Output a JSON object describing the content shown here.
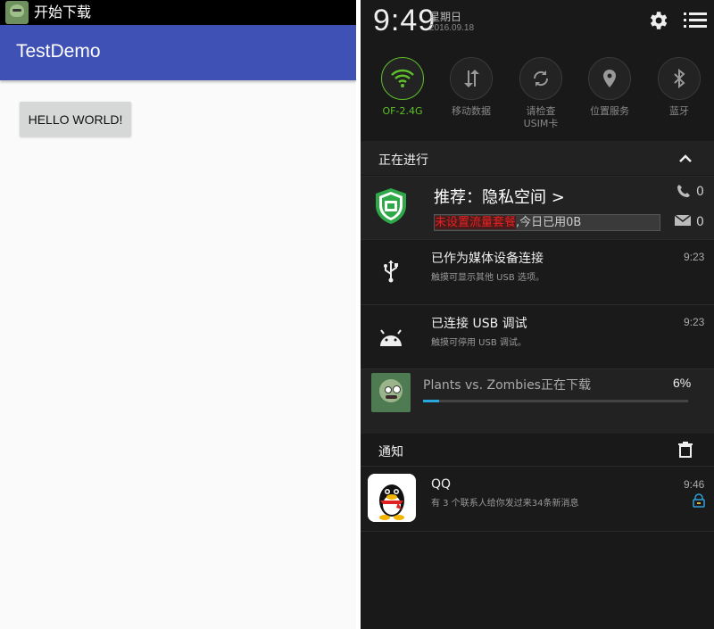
{
  "left": {
    "status_title": "开始下载",
    "app_title": "TestDemo",
    "button_label": "HELLO WORLD!"
  },
  "right": {
    "time": "9:49",
    "weekday": "星期日",
    "date": "2016.09.18",
    "quick_settings": [
      {
        "label": "OF-2.4G",
        "icon": "wifi-icon",
        "active": true
      },
      {
        "label": "移动数据",
        "icon": "mobile-data-icon",
        "active": false
      },
      {
        "label": "请检查USIM卡",
        "icon": "sync-icon",
        "active": false
      },
      {
        "label": "位置服务",
        "icon": "location-icon",
        "active": false
      },
      {
        "label": "蓝牙",
        "icon": "bluetooth-icon",
        "active": false
      }
    ],
    "ongoing_header": "正在进行",
    "security": {
      "title": "推荐：隐私空间 >",
      "warning": "未设置流量套餐",
      "usage": ",今日已用0B",
      "phone_count": "0",
      "mail_count": "0",
      "accent": "#e32222"
    },
    "usb": {
      "title": "已作为媒体设备连接",
      "subtitle": "触摸可显示其他 USB 选项。",
      "time": "9:23"
    },
    "adb": {
      "title": "已连接 USB 调试",
      "subtitle": "触摸可停用 USB 调试。",
      "time": "9:23"
    },
    "download": {
      "title": "Plants vs. Zombies正在下载",
      "percent_label": "6%",
      "progress": 0.06
    },
    "notifications_header": "通知",
    "qq": {
      "title": "QQ",
      "subtitle": "有 3 个联系人给你发过来34条新消息",
      "time": "9:46"
    }
  }
}
